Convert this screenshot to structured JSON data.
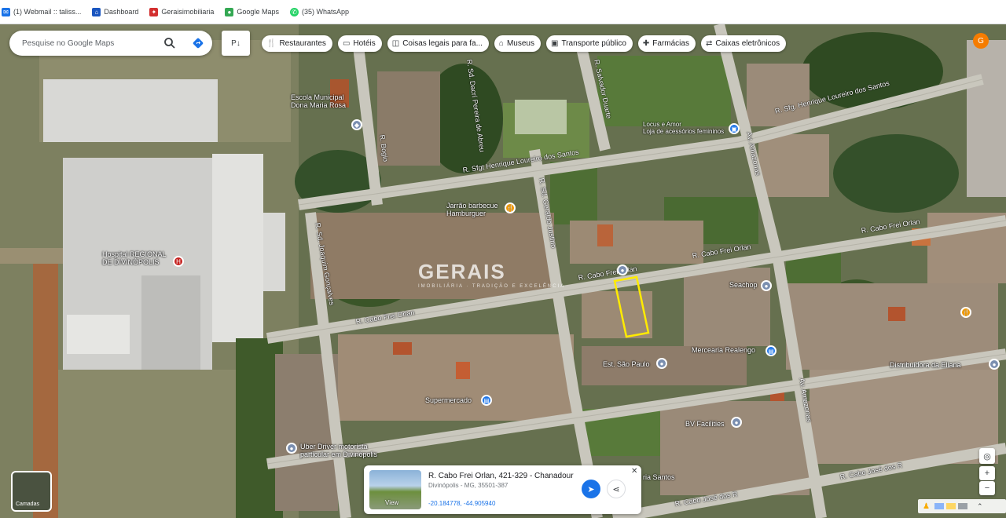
{
  "bookmarks": [
    {
      "label": "(1) Webmail :: taliss...",
      "icon": "webmail-icon",
      "color": "#1a73e8"
    },
    {
      "label": "Dashboard",
      "icon": "dashboard-icon",
      "color": "#1a56c0"
    },
    {
      "label": "Geraisimobiliaria",
      "icon": "gerais-icon",
      "color": "#d32f2f"
    },
    {
      "label": "Google Maps",
      "icon": "google-maps-icon",
      "color": "#34a853"
    },
    {
      "label": "(35) WhatsApp",
      "icon": "whatsapp-icon",
      "color": "#25d366"
    }
  ],
  "search": {
    "placeholder": "Pesquise no Google Maps"
  },
  "layers": {
    "label": "P↓"
  },
  "chips": [
    {
      "label": "Restaurantes",
      "icon": "restaurant-icon"
    },
    {
      "label": "Hotéis",
      "icon": "hotel-icon"
    },
    {
      "label": "Coisas legais para fa...",
      "icon": "camera-icon"
    },
    {
      "label": "Museus",
      "icon": "museum-icon"
    },
    {
      "label": "Transporte público",
      "icon": "transit-icon"
    },
    {
      "label": "Farmácias",
      "icon": "pharmacy-icon"
    },
    {
      "label": "Caixas eletrônicos",
      "icon": "atm-icon"
    }
  ],
  "avatar": "G",
  "places": {
    "escola": "Escola Municipal\nDona Maria Rosa",
    "hospital": "Hospital REGIONAL\nDE DIVINÓPOLIS",
    "jarrao": "Jarrão barbecue\nHamburguer",
    "locus": "Locus e Amor\nLoja de acessórios femininos",
    "seachop": "Seachop",
    "mercearia": "Mercearia Realengo",
    "est": "Est. São Paulo",
    "supermercado": "Supermercado",
    "distribuidora": "Distribuidora da Eliana",
    "bv": "BV Facilities",
    "uber": "Uber Driver motorista\nparticular em Divinópolis",
    "santos": "ria Santos"
  },
  "streets": {
    "sfgt": "R. Sfgt Henrique Loureiro dos Santos",
    "sfgt2": "R. Sfg. Henrique Loureiro dos Santos",
    "orlan1": "R. Cabo Frei Orlan",
    "orlan2": "R. Cabo Frei Orlan",
    "orlan3": "R. Cabo Frei Orlan",
    "orlan4": "R. Cabo Frei Orlan",
    "jose1": "R. Cabo José dos R",
    "jose2": "R. Cabo José dos R",
    "amazonas1": "Av. Amazonas",
    "amazonas2": "Av. Amazonas",
    "geraldo": "R. Sd. Geraldo Justino",
    "joaquim": "R. Sd. Joaquim Gonçalves",
    "bogio": "R. Bogio",
    "dacri": "R. Sd. Dacrí Pereira de Abreu",
    "salvador": "R. Salvador Duarte"
  },
  "watermark": {
    "name": "GERAIS",
    "tagline": "IMOBILIÁRIA · TRADIÇÃO E EXCELÊNCIA"
  },
  "card": {
    "title": "R. Cabo Frei Orlan, 421-329 - Chanadour",
    "subtitle": "Divinópolis - MG, 35501-387",
    "coords": "-20.184778, -44.905940",
    "thumb_label": "View"
  },
  "camera": {
    "label": "Camadas"
  },
  "colors": {
    "accent": "#1a73e8",
    "plot": "#ffeb00",
    "street": "#c9c7bd"
  }
}
